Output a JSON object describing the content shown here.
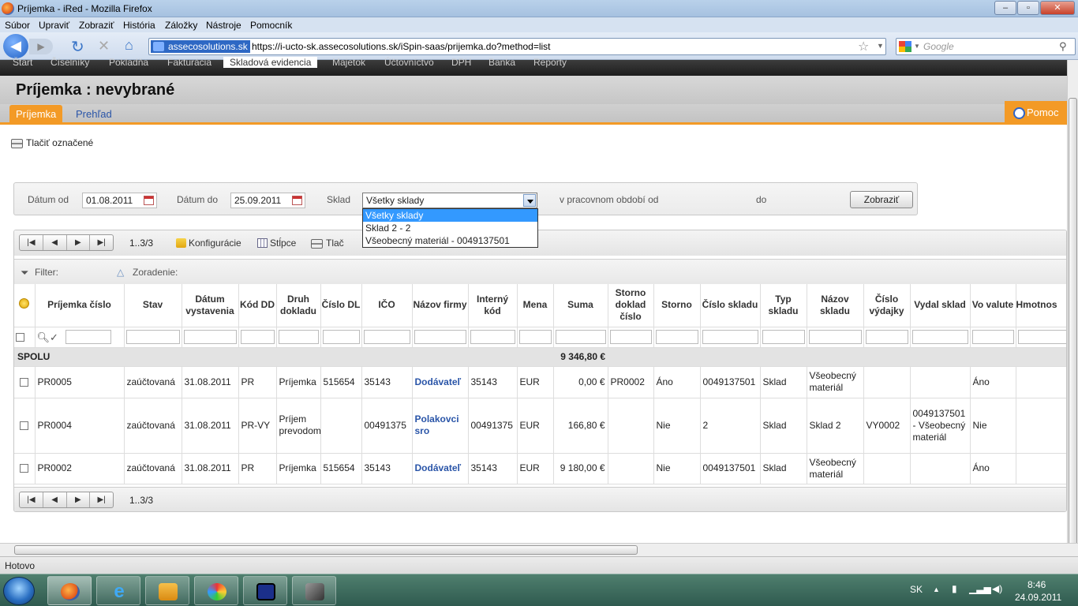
{
  "browser": {
    "window_title": "Príjemka - iRed - Mozilla Firefox",
    "menu": [
      "Súbor",
      "Upraviť",
      "Zobraziť",
      "História",
      "Záložky",
      "Nástroje",
      "Pomocník"
    ],
    "site_badge": "assecosolutions.sk",
    "url": "https://i-ucto-sk.assecosolutions.sk/iSpin-saas/prijemka.do?method=list",
    "search_placeholder": "Google",
    "status": "Hotovo"
  },
  "app": {
    "nav": [
      "Štart",
      "Číselníky",
      "Pokladňa",
      "Fakturácia",
      "Skladová evidencia",
      "Majetok",
      "Účtovníctvo",
      "DPH",
      "Banka",
      "Reporty"
    ],
    "title": "Príjemka : nevybrané",
    "tabs": {
      "active": "Príjemka",
      "other": "Prehľad"
    },
    "help": "Pomoc",
    "print_selected": "Tlačiť označené"
  },
  "filters": {
    "date_from_label": "Dátum od",
    "date_from": "01.08.2011",
    "date_to_label": "Dátum do",
    "date_to": "25.09.2011",
    "warehouse_label": "Sklad",
    "warehouse_value": "Všetky sklady",
    "period_label": "v pracovnom období od",
    "period_to_label": "do",
    "show_button": "Zobraziť",
    "warehouse_options": [
      "Všetky sklady",
      "Sklad 2 - 2",
      "Všeobecný materiál - 0049137501"
    ]
  },
  "grid": {
    "pager_count": "1..3/3",
    "toolbar": {
      "config": "Konfigurácie",
      "columns": "Stĺpce",
      "print": "Tlač"
    },
    "filter_label": "Filter:",
    "sort_label": "Zoradenie:",
    "columns": [
      "Príjemka číslo",
      "Stav",
      "Dátum vystavenia",
      "Kód DD",
      "Druh dokladu",
      "Číslo DL",
      "IČO",
      "Názov firmy",
      "Interný kód",
      "Mena",
      "Suma",
      "Storno doklad číslo",
      "Storno",
      "Číslo skladu",
      "Typ skladu",
      "Názov skladu",
      "Číslo výdajky",
      "Vydal sklad",
      "Vo valute",
      "Hmotnos"
    ],
    "total_label": "SPOLU",
    "total_sum": "9 346,80 €",
    "rows": [
      [
        "PR0005",
        "zaúčtovaná",
        "31.08.2011",
        "PR",
        "Príjemka",
        "515654",
        "35143",
        "Dodávateľ",
        "35143",
        "EUR",
        "0,00 €",
        "PR0002",
        "Áno",
        "0049137501",
        "Sklad",
        "Všeobecný materiál",
        "",
        "",
        "Áno",
        ""
      ],
      [
        "PR0004",
        "zaúčtovaná",
        "31.08.2011",
        "PR-VY",
        "Príjem prevodom",
        "",
        "00491375",
        "Polakovci sro",
        "00491375",
        "EUR",
        "166,80 €",
        "",
        "Nie",
        "2",
        "Sklad",
        "Sklad 2",
        "VY0002",
        "0049137501 - Všeobecný materiál",
        "Nie",
        ""
      ],
      [
        "PR0002",
        "zaúčtovaná",
        "31.08.2011",
        "PR",
        "Príjemka",
        "515654",
        "35143",
        "Dodávateľ",
        "35143",
        "EUR",
        "9 180,00 €",
        "",
        "Nie",
        "0049137501",
        "Sklad",
        "Všeobecný materiál",
        "",
        "",
        "Áno",
        ""
      ]
    ]
  },
  "taskbar": {
    "lang": "SK",
    "time": "8:46",
    "date": "24.09.2011"
  }
}
